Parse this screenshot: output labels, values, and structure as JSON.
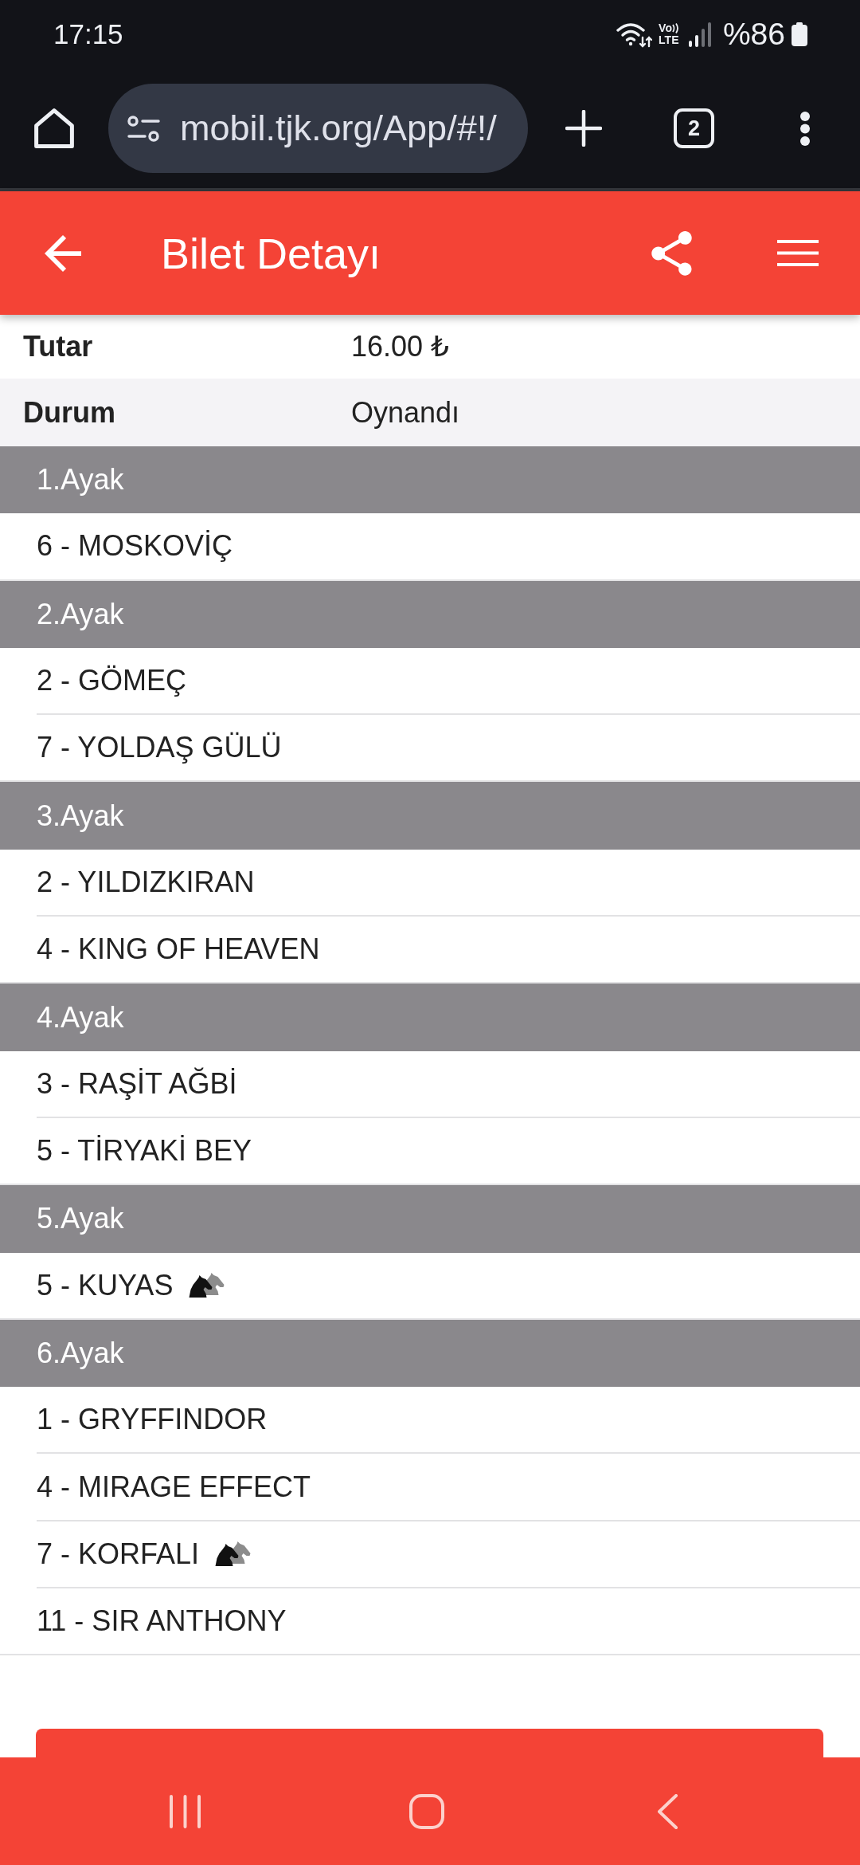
{
  "status_bar": {
    "time": "17:15",
    "network": {
      "top": "Vo",
      "bottom": "LTE"
    },
    "battery": "%86"
  },
  "browser": {
    "url": "mobil.tjk.org/App/#!/",
    "tab_count": "2"
  },
  "app_bar": {
    "title": "Bilet Detayı"
  },
  "details": [
    {
      "label": "Tutar",
      "value": "16.00 ₺"
    },
    {
      "label": "Durum",
      "value": "Oynandı"
    }
  ],
  "legs": [
    {
      "title": "1.Ayak",
      "horses": [
        {
          "name": "6 - MOSKOVİÇ",
          "ekuri": false
        }
      ]
    },
    {
      "title": "2.Ayak",
      "horses": [
        {
          "name": "2 - GÖMEÇ",
          "ekuri": false
        },
        {
          "name": "7 - YOLDAŞ GÜLÜ",
          "ekuri": false
        }
      ]
    },
    {
      "title": "3.Ayak",
      "horses": [
        {
          "name": "2 - YILDIZKIRAN",
          "ekuri": false
        },
        {
          "name": "4 - KING OF HEAVEN",
          "ekuri": false
        }
      ]
    },
    {
      "title": "4.Ayak",
      "horses": [
        {
          "name": "3 - RAŞİT AĞBİ",
          "ekuri": false
        },
        {
          "name": "5 - TİRYAKİ BEY",
          "ekuri": false
        }
      ]
    },
    {
      "title": "5.Ayak",
      "horses": [
        {
          "name": "5 - KUYAS",
          "ekuri": true
        }
      ]
    },
    {
      "title": "6.Ayak",
      "horses": [
        {
          "name": "1 - GRYFFINDOR",
          "ekuri": false
        },
        {
          "name": "4 - MIRAGE EFFECT",
          "ekuri": false
        },
        {
          "name": "7 - KORFALI",
          "ekuri": true
        },
        {
          "name": "11 - SIR ANTHONY",
          "ekuri": false
        }
      ]
    }
  ]
}
